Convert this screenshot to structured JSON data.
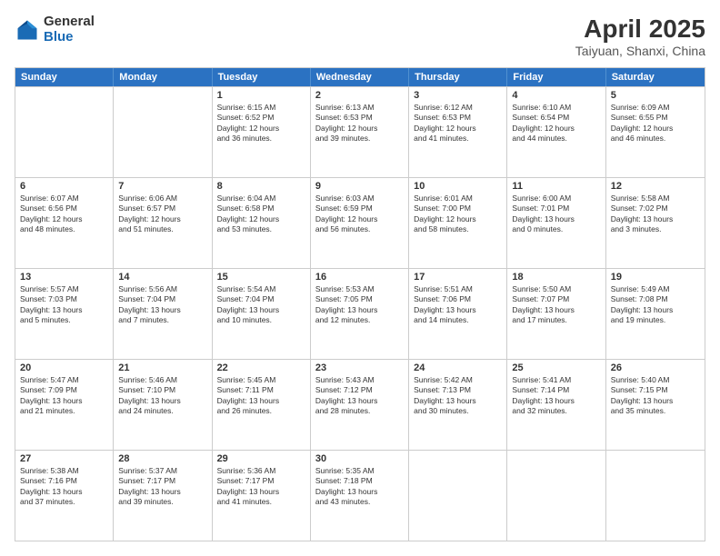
{
  "logo": {
    "general": "General",
    "blue": "Blue"
  },
  "title": "April 2025",
  "subtitle": "Taiyuan, Shanxi, China",
  "days": [
    "Sunday",
    "Monday",
    "Tuesday",
    "Wednesday",
    "Thursday",
    "Friday",
    "Saturday"
  ],
  "weeks": [
    [
      {
        "day": "",
        "content": ""
      },
      {
        "day": "",
        "content": ""
      },
      {
        "day": "1",
        "content": "Sunrise: 6:15 AM\nSunset: 6:52 PM\nDaylight: 12 hours\nand 36 minutes."
      },
      {
        "day": "2",
        "content": "Sunrise: 6:13 AM\nSunset: 6:53 PM\nDaylight: 12 hours\nand 39 minutes."
      },
      {
        "day": "3",
        "content": "Sunrise: 6:12 AM\nSunset: 6:53 PM\nDaylight: 12 hours\nand 41 minutes."
      },
      {
        "day": "4",
        "content": "Sunrise: 6:10 AM\nSunset: 6:54 PM\nDaylight: 12 hours\nand 44 minutes."
      },
      {
        "day": "5",
        "content": "Sunrise: 6:09 AM\nSunset: 6:55 PM\nDaylight: 12 hours\nand 46 minutes."
      }
    ],
    [
      {
        "day": "6",
        "content": "Sunrise: 6:07 AM\nSunset: 6:56 PM\nDaylight: 12 hours\nand 48 minutes."
      },
      {
        "day": "7",
        "content": "Sunrise: 6:06 AM\nSunset: 6:57 PM\nDaylight: 12 hours\nand 51 minutes."
      },
      {
        "day": "8",
        "content": "Sunrise: 6:04 AM\nSunset: 6:58 PM\nDaylight: 12 hours\nand 53 minutes."
      },
      {
        "day": "9",
        "content": "Sunrise: 6:03 AM\nSunset: 6:59 PM\nDaylight: 12 hours\nand 56 minutes."
      },
      {
        "day": "10",
        "content": "Sunrise: 6:01 AM\nSunset: 7:00 PM\nDaylight: 12 hours\nand 58 minutes."
      },
      {
        "day": "11",
        "content": "Sunrise: 6:00 AM\nSunset: 7:01 PM\nDaylight: 13 hours\nand 0 minutes."
      },
      {
        "day": "12",
        "content": "Sunrise: 5:58 AM\nSunset: 7:02 PM\nDaylight: 13 hours\nand 3 minutes."
      }
    ],
    [
      {
        "day": "13",
        "content": "Sunrise: 5:57 AM\nSunset: 7:03 PM\nDaylight: 13 hours\nand 5 minutes."
      },
      {
        "day": "14",
        "content": "Sunrise: 5:56 AM\nSunset: 7:04 PM\nDaylight: 13 hours\nand 7 minutes."
      },
      {
        "day": "15",
        "content": "Sunrise: 5:54 AM\nSunset: 7:04 PM\nDaylight: 13 hours\nand 10 minutes."
      },
      {
        "day": "16",
        "content": "Sunrise: 5:53 AM\nSunset: 7:05 PM\nDaylight: 13 hours\nand 12 minutes."
      },
      {
        "day": "17",
        "content": "Sunrise: 5:51 AM\nSunset: 7:06 PM\nDaylight: 13 hours\nand 14 minutes."
      },
      {
        "day": "18",
        "content": "Sunrise: 5:50 AM\nSunset: 7:07 PM\nDaylight: 13 hours\nand 17 minutes."
      },
      {
        "day": "19",
        "content": "Sunrise: 5:49 AM\nSunset: 7:08 PM\nDaylight: 13 hours\nand 19 minutes."
      }
    ],
    [
      {
        "day": "20",
        "content": "Sunrise: 5:47 AM\nSunset: 7:09 PM\nDaylight: 13 hours\nand 21 minutes."
      },
      {
        "day": "21",
        "content": "Sunrise: 5:46 AM\nSunset: 7:10 PM\nDaylight: 13 hours\nand 24 minutes."
      },
      {
        "day": "22",
        "content": "Sunrise: 5:45 AM\nSunset: 7:11 PM\nDaylight: 13 hours\nand 26 minutes."
      },
      {
        "day": "23",
        "content": "Sunrise: 5:43 AM\nSunset: 7:12 PM\nDaylight: 13 hours\nand 28 minutes."
      },
      {
        "day": "24",
        "content": "Sunrise: 5:42 AM\nSunset: 7:13 PM\nDaylight: 13 hours\nand 30 minutes."
      },
      {
        "day": "25",
        "content": "Sunrise: 5:41 AM\nSunset: 7:14 PM\nDaylight: 13 hours\nand 32 minutes."
      },
      {
        "day": "26",
        "content": "Sunrise: 5:40 AM\nSunset: 7:15 PM\nDaylight: 13 hours\nand 35 minutes."
      }
    ],
    [
      {
        "day": "27",
        "content": "Sunrise: 5:38 AM\nSunset: 7:16 PM\nDaylight: 13 hours\nand 37 minutes."
      },
      {
        "day": "28",
        "content": "Sunrise: 5:37 AM\nSunset: 7:17 PM\nDaylight: 13 hours\nand 39 minutes."
      },
      {
        "day": "29",
        "content": "Sunrise: 5:36 AM\nSunset: 7:17 PM\nDaylight: 13 hours\nand 41 minutes."
      },
      {
        "day": "30",
        "content": "Sunrise: 5:35 AM\nSunset: 7:18 PM\nDaylight: 13 hours\nand 43 minutes."
      },
      {
        "day": "",
        "content": ""
      },
      {
        "day": "",
        "content": ""
      },
      {
        "day": "",
        "content": ""
      }
    ]
  ]
}
